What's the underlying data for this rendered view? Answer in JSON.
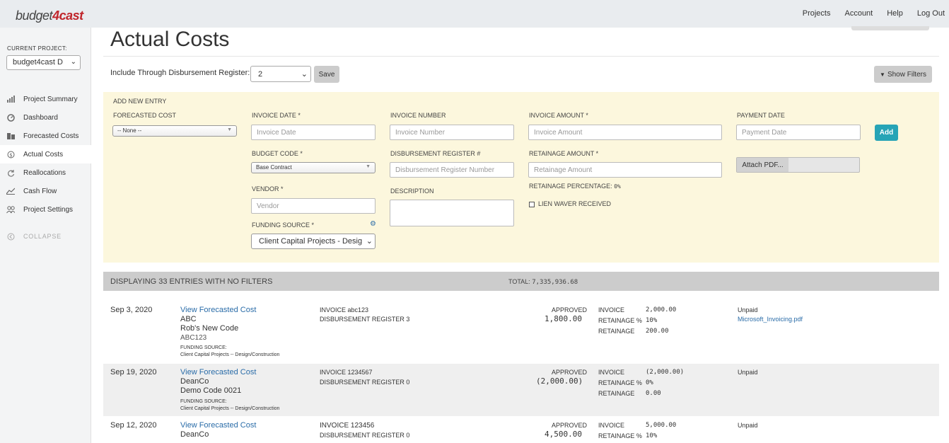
{
  "brand": {
    "name_part1": "budget",
    "name_part2": "4cast"
  },
  "top_nav": {
    "projects": "Projects",
    "account": "Account",
    "help": "Help",
    "logout": "Log Out"
  },
  "sidebar": {
    "current_project_label": "CURRENT PROJECT:",
    "current_project_value": "budget4cast D",
    "items": [
      {
        "label": "Project Summary",
        "icon": "bar-chart-icon"
      },
      {
        "label": "Dashboard",
        "icon": "gauge-icon"
      },
      {
        "label": "Forecasted Costs",
        "icon": "file-icon"
      },
      {
        "label": "Actual Costs",
        "icon": "dollar-icon",
        "active": true
      },
      {
        "label": "Reallocations",
        "icon": "refresh-icon"
      },
      {
        "label": "Cash Flow",
        "icon": "line-chart-icon"
      },
      {
        "label": "Project Settings",
        "icon": "users-icon"
      }
    ],
    "collapse_label": "COLLAPSE"
  },
  "page": {
    "title": "Actual Costs",
    "include_label": "Include Through Disbursement Register:",
    "include_value": "2",
    "save_label": "Save",
    "show_filters_label": "Show Filters"
  },
  "entry_form": {
    "heading": "ADD NEW ENTRY",
    "forecasted_cost_label": "FORECASTED COST",
    "forecasted_cost_value": "-- None --",
    "invoice_date_label": "INVOICE DATE *",
    "invoice_date_placeholder": "Invoice Date",
    "budget_code_label": "BUDGET CODE *",
    "budget_code_value": "Base Contract",
    "vendor_label": "VENDOR *",
    "vendor_placeholder": "Vendor",
    "funding_source_label": "FUNDING SOURCE *",
    "funding_source_value": "Client Capital Projects - Desig",
    "invoice_number_label": "INVOICE NUMBER",
    "invoice_number_placeholder": "Invoice Number",
    "disb_reg_label": "DISBURSEMENT REGISTER #",
    "disb_reg_placeholder": "Disbursement Register Number",
    "description_label": "DESCRIPTION",
    "invoice_amount_label": "INVOICE AMOUNT *",
    "invoice_amount_placeholder": "Invoice Amount",
    "retainage_amount_label": "RETAINAGE AMOUNT *",
    "retainage_amount_placeholder": "Retainage Amount",
    "retainage_pct_label": "RETAINAGE PERCENTAGE:",
    "retainage_pct_value": "0%",
    "lien_label": "LIEN WAVER RECEIVED",
    "payment_date_label": "PAYMENT DATE",
    "payment_date_placeholder": "Payment Date",
    "add_label": "Add",
    "attach_label": "Attach PDF..."
  },
  "summary": {
    "text": "DISPLAYING 33 ENTRIES WITH NO FILTERS",
    "total_label": "TOTAL:",
    "total_value": "7,335,936.68"
  },
  "entries": [
    {
      "date": "Sep 3, 2020",
      "link": "View Forecasted Cost",
      "vendor": "ABC",
      "code_name": "Rob's New Code",
      "code": "ABC123",
      "funding_label": "FUNDING SOURCE:",
      "funding_value": "Client Capital Projects -- Design/Construction",
      "invoice": "INVOICE abc123",
      "disb": "DISBURSEMENT REGISTER 3",
      "approved_label": "APPROVED",
      "approved_value": "1,800.00",
      "k_invoice": "INVOICE",
      "v_invoice": "2,000.00",
      "k_ret_pct": "RETAINAGE %",
      "v_ret_pct": "10%",
      "k_ret": "RETAINAGE",
      "v_ret": "200.00",
      "status": "Unpaid",
      "file": "Microsoft_Invoicing.pdf"
    },
    {
      "date": "Sep 19, 2020",
      "link": "View Forecasted Cost",
      "vendor": "DeanCo",
      "code_name": "Demo Code 0021",
      "code": "",
      "funding_label": "FUNDING SOURCE:",
      "funding_value": "Client Capital Projects -- Design/Construction",
      "invoice": "INVOICE 1234567",
      "disb": "DISBURSEMENT REGISTER 0",
      "approved_label": "APPROVED",
      "approved_value": "(2,000.00)",
      "k_invoice": "INVOICE",
      "v_invoice": "(2,000.00)",
      "k_ret_pct": "RETAINAGE %",
      "v_ret_pct": "0%",
      "k_ret": "RETAINAGE",
      "v_ret": "0.00",
      "status": "Unpaid",
      "file": ""
    },
    {
      "date": "Sep 12, 2020",
      "link": "View Forecasted Cost",
      "vendor": "DeanCo",
      "code_name": "",
      "code": "",
      "funding_label": "",
      "funding_value": "",
      "invoice": "INVOICE 123456",
      "disb": "DISBURSEMENT REGISTER 0",
      "approved_label": "APPROVED",
      "approved_value": "4,500.00",
      "k_invoice": "INVOICE",
      "v_invoice": "5,000.00",
      "k_ret_pct": "RETAINAGE %",
      "v_ret_pct": "10%",
      "k_ret": "",
      "v_ret": "",
      "status": "Unpaid",
      "file": ""
    }
  ]
}
